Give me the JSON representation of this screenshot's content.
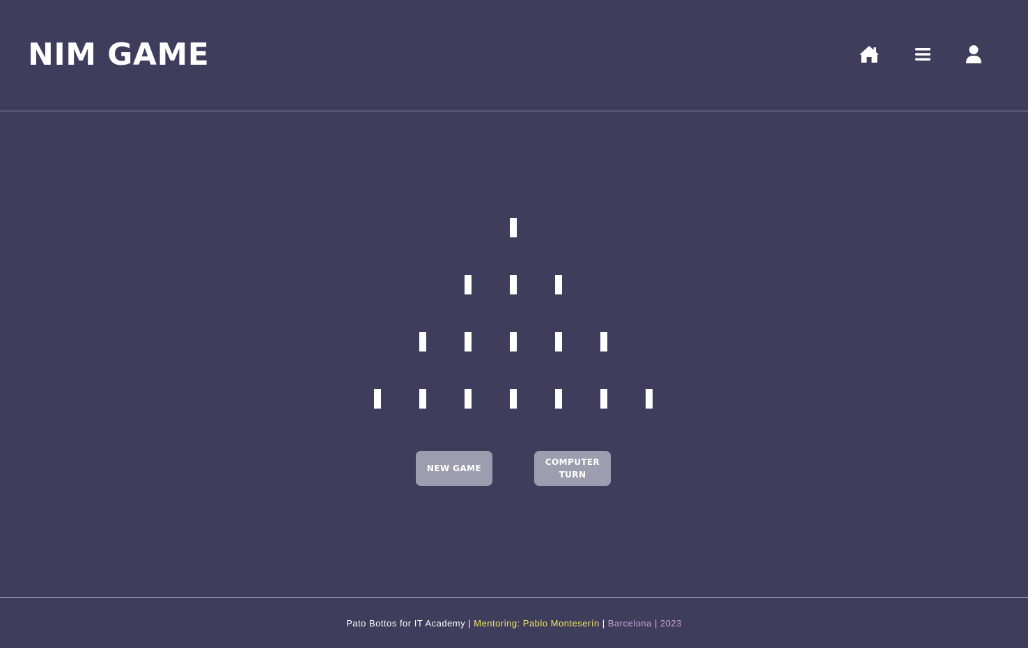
{
  "header": {
    "title": "NIM GAME",
    "icons": [
      "home-icon",
      "menu-icon",
      "user-icon"
    ]
  },
  "board": {
    "rows": [
      1,
      3,
      5,
      7
    ]
  },
  "buttons": {
    "new_game": "NEW GAME",
    "computer_turn": "COMPUTER TURN"
  },
  "footer": {
    "author": "Pato Bottos for IT Academy",
    "separator": " | ",
    "mentoring": "Mentoring: Pablo Monteserín",
    "location": "Barcelona",
    "year": "2023"
  },
  "colors": {
    "background": "#3f3d5c",
    "button": "#9e9caf",
    "mentoring_text": "#f5e663",
    "location_text": "#c9a3dc"
  }
}
